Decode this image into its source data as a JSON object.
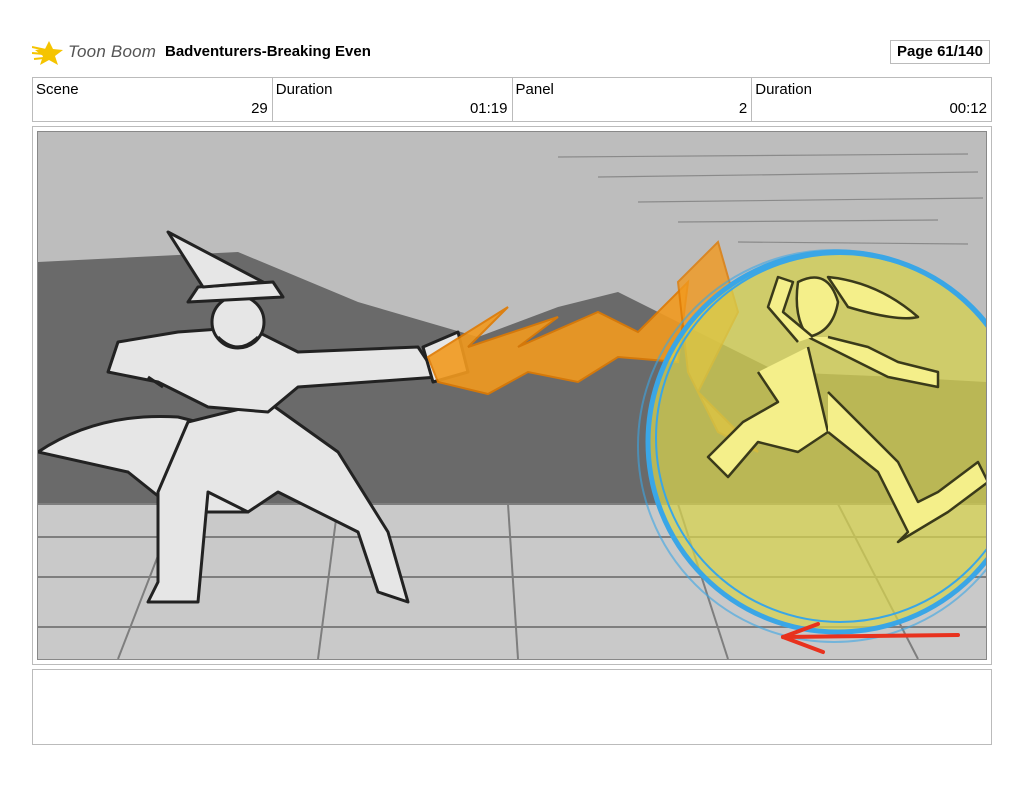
{
  "header": {
    "logo_text": "Toon Boom",
    "title": "Badventurers-Breaking Even",
    "page_label": "Page  61/140"
  },
  "info": {
    "scene_label": "Scene",
    "scene_value": "29",
    "duration_label": "Duration",
    "duration_value": "01:19",
    "panel_label": "Panel",
    "panel_value": "2",
    "panel_duration_label": "Duration",
    "panel_duration_value": "00:12"
  },
  "panel": {
    "icon": "storyboard-sketch-image",
    "colors": {
      "sky": "#bdbdbd",
      "hills": "#6a6a6a",
      "floor": "#c9c9c9",
      "wizard": "#e6e6e6",
      "magic": "#f29a1f",
      "shield_fill": "#d6d24f",
      "shield_ring": "#3aa6e6",
      "arrow": "#e8321e"
    }
  },
  "notes": {
    "text": ""
  }
}
